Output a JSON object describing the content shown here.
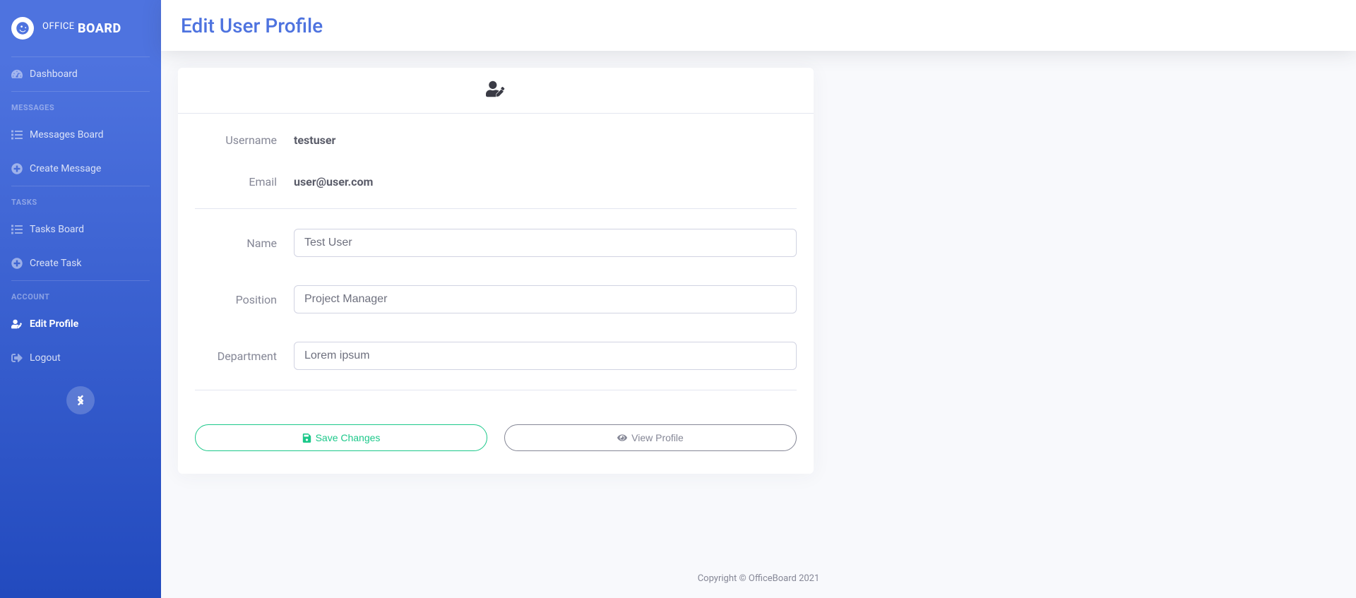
{
  "brand": {
    "office": "OFFICE",
    "board": "BOARD"
  },
  "sidebar": {
    "dashboard": "Dashboard",
    "heading_messages": "MESSAGES",
    "messages_board": "Messages Board",
    "create_message": "Create Message",
    "heading_tasks": "TASKS",
    "tasks_board": "Tasks Board",
    "create_task": "Create Task",
    "heading_account": "ACCOUNT",
    "edit_profile": "Edit Profile",
    "logout": "Logout"
  },
  "page": {
    "title": "Edit User Profile"
  },
  "form": {
    "username_label": "Username",
    "username_value": "testuser",
    "email_label": "Email",
    "email_value": "user@user.com",
    "name_label": "Name",
    "name_value": "Test User",
    "position_label": "Position",
    "position_value": "Project Manager",
    "department_label": "Department",
    "department_value": "Lorem ipsum"
  },
  "buttons": {
    "save": "Save Changes",
    "view": "View Profile"
  },
  "footer": {
    "copyright": "Copyright © OfficeBoard 2021"
  }
}
